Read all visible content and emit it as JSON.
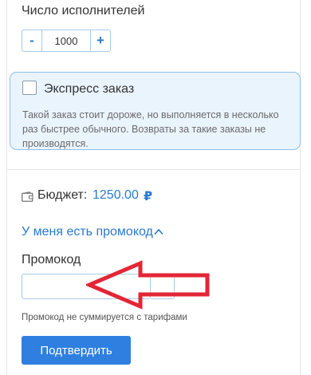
{
  "performers": {
    "label": "Число исполнителей",
    "minus": "-",
    "value": "1000",
    "plus": "+"
  },
  "express": {
    "checked": false,
    "title": "Экспресс заказ",
    "description": "Такой заказ стоит дороже, но выполняется в несколько раз быстрее обычного. Возвраты за такие заказы не производятся."
  },
  "budget": {
    "label": "Бюджет:",
    "value": "1250.00",
    "currency": "₽",
    "icon": "wallet-icon"
  },
  "promo": {
    "toggle_label": "У меня есть промокод",
    "toggle_icon": "chevron-up-icon",
    "field_label": "Промокод",
    "input_value": "",
    "note": "Промокод не суммируется с тарифами"
  },
  "confirm_label": "Подтвердить",
  "colors": {
    "accent": "#2a7ad0",
    "button": "#2f7fe0",
    "express_bg": "#eaf4fd",
    "express_border": "#8ec0ea",
    "arrow": "#e32636"
  }
}
